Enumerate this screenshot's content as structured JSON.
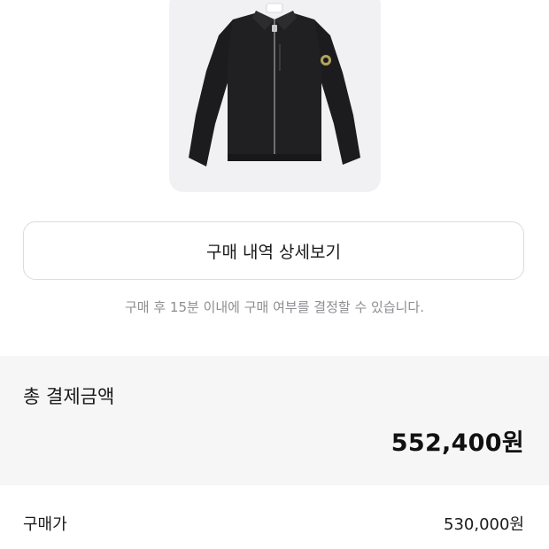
{
  "product": {
    "image_alt": "black zip-up shirt jacket"
  },
  "actions": {
    "detail_button_label": "구매 내역 상세보기"
  },
  "notice": {
    "text": "구매 후 15분 이내에 구매 여부를 결정할 수 있습니다."
  },
  "summary": {
    "title": "총 결제금액",
    "total_amount": "552,400원"
  },
  "price_rows": [
    {
      "label": "구매가",
      "value": "530,000원"
    }
  ],
  "colors": {
    "image_bg": "#f1f1f3",
    "summary_bg": "#f6f6f7",
    "notice_text": "#8e8e93",
    "border": "#dcdcde"
  }
}
